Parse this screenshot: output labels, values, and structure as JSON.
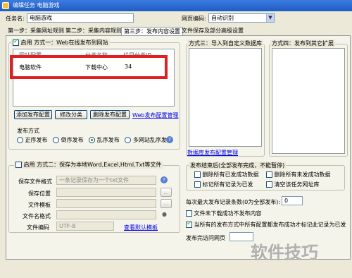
{
  "window": {
    "title": "编辑任务 电脑游戏"
  },
  "task_name": {
    "label": "任务名:",
    "value": "电脑游戏"
  },
  "encoding": {
    "label": "网页编码:",
    "value": "自动识别"
  },
  "steps": [
    {
      "label": "第一步：采集网址规则"
    },
    {
      "label": "第二步：采集内容规则"
    },
    {
      "label": "第三步：发布内容设置"
    },
    {
      "label": "文件保存及部分高级设置"
    }
  ],
  "method1": {
    "label": "启用  方式一：Web在线发布到网站",
    "columns": [
      "网站配置",
      "分类名称",
      "栏目分类ID"
    ],
    "rows": [
      [
        "电脑软件",
        "下载中心",
        "34"
      ]
    ],
    "buttons": {
      "add": "添加发布配置",
      "edit": "修改分类",
      "delete": "删除发布配置"
    },
    "manage_link": "Web发布配置管理",
    "publish_mode_label": "发布方式",
    "modes": [
      "正序发布",
      "倒序发布",
      "乱序发布",
      "多网站乱序发布"
    ]
  },
  "method2": {
    "label": "启用  方式二：保存为本地Word,Excel,Html,Txt等文件",
    "format_label": "保存文件格式",
    "format_value": "一条记录保存为一个txt文件",
    "location_label": "保存位置",
    "template_label": "文件模板",
    "name_format_label": "文件名格式",
    "file_encoding_label": "文件编码",
    "file_encoding_value": "UTF-8",
    "view_template_link": "查看默认模板",
    "browse": "..."
  },
  "method3": {
    "label": "方式三：导入到自定义数据库",
    "link": "数据库发布配置管理"
  },
  "method4": {
    "label": "方式四：发布到其它扩展"
  },
  "after_publish": {
    "title": "发布结束后(全部发布完成，不能暂停)",
    "options": [
      "删除所有已发成功数据",
      "删除所有未发成功数据",
      "标记所有记录为已发",
      "清空该任务网址库"
    ]
  },
  "max_records": {
    "label": "每次最大发布记录条数(0为全部发布):",
    "value": "0"
  },
  "no_download_option": {
    "label": "文件未下载成功不发布内容"
  },
  "mark_option": {
    "label": "当所有的发布方式中所有配置都发布成功才标记此记录为已发"
  },
  "interval_label": "发布完访问网页",
  "watermark": "软件技巧",
  "colors": {
    "titlebar": "#1f5cc4",
    "highlight": "#e02020",
    "dialog": "#ece9d8"
  }
}
